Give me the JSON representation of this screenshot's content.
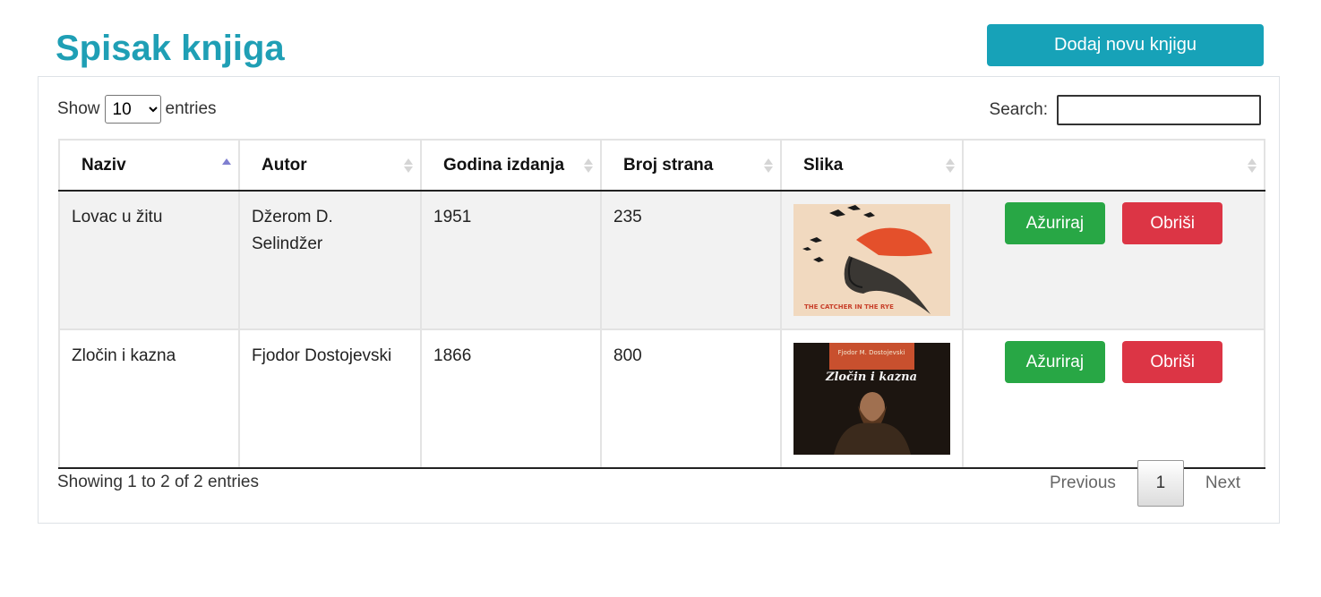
{
  "header": {
    "title": "Spisak knjiga",
    "add_button": "Dodaj novu knjigu"
  },
  "controls": {
    "show_label": "Show",
    "page_length": "10",
    "entries_label": "entries",
    "search_label": "Search:",
    "search_value": ""
  },
  "table": {
    "columns": [
      "Naziv",
      "Autor",
      "Godina izdanja",
      "Broj strana",
      "Slika",
      ""
    ],
    "sorted_column": "Naziv",
    "rows": [
      {
        "naziv": "Lovac u žitu",
        "autor": "Džerom D. Selindžer",
        "godina": "1951",
        "strane": "235",
        "cover_text": "THE CATCHER IN THE RYE",
        "update_label": "Ažuriraj",
        "delete_label": "Obriši"
      },
      {
        "naziv": "Zločin i kazna",
        "autor": "Fjodor Dostojevski",
        "godina": "1866",
        "strane": "800",
        "cover_author": "Fjodor M. Dostojevski",
        "cover_title": "Zločin i kazna",
        "update_label": "Ažuriraj",
        "delete_label": "Obriši"
      }
    ]
  },
  "footer": {
    "info": "Showing 1 to 2 of 2 entries",
    "previous": "Previous",
    "current_page": "1",
    "next": "Next"
  },
  "colors": {
    "title": "#1f9fb5",
    "primary": "#17a2b8",
    "success": "#28a745",
    "danger": "#dc3545"
  }
}
